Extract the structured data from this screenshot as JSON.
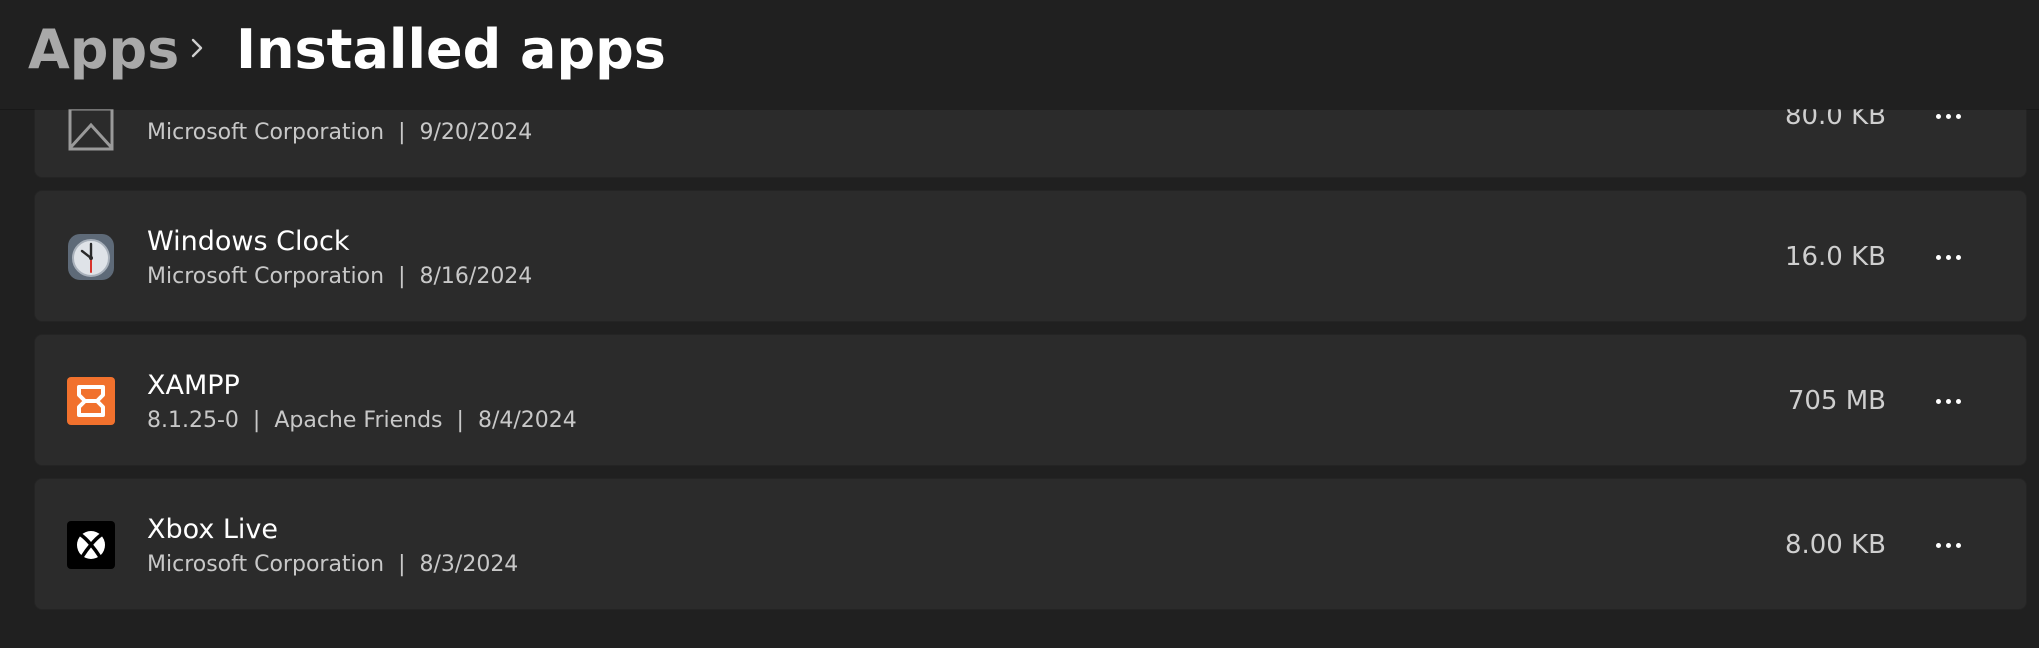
{
  "header": {
    "breadcrumb_parent": "Apps",
    "page_title": "Installed apps"
  },
  "apps": [
    {
      "name": "",
      "publisher": "Microsoft Corporation",
      "date": "9/20/2024",
      "size": "80.0 KB",
      "icon": "mail-icon"
    },
    {
      "name": "Windows Clock",
      "publisher": "Microsoft Corporation",
      "date": "8/16/2024",
      "size": "16.0 KB",
      "icon": "clock-icon"
    },
    {
      "name": "XAMPP",
      "version": "8.1.25-0",
      "publisher": "Apache Friends",
      "date": "8/4/2024",
      "size": "705 MB",
      "icon": "xampp-icon"
    },
    {
      "name": "Xbox Live",
      "publisher": "Microsoft Corporation",
      "date": "8/3/2024",
      "size": "8.00 KB",
      "icon": "xbox-icon"
    }
  ],
  "colors": {
    "background": "#202020",
    "card": "#2b2b2b",
    "xampp_orange": "#f1712d"
  }
}
